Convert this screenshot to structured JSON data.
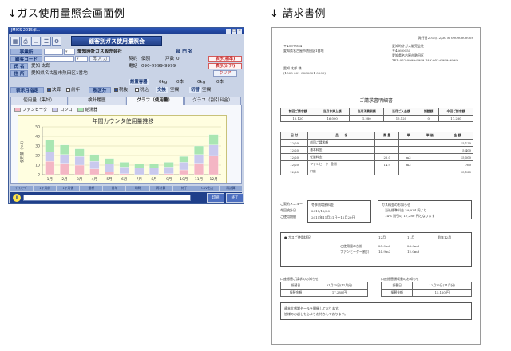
{
  "headings": {
    "left": "↓ガス使用量照会画面例",
    "right": "↓ 請求書例"
  },
  "app": {
    "title": "JMICS 2015年...",
    "banner": "顧客別ガス使用量照会",
    "office_label": "事業所",
    "office_value": "愛知時計ガス販売会社",
    "dept_label": "部 門 名",
    "customer_code_label": "顧客コード",
    "input_button": "再 入 力",
    "name_label": "氏 名",
    "name_value": "愛知 太郎",
    "address_label": "住 所",
    "address_value": "愛知県名古屋市熱田区1番地",
    "contract_label": "契約",
    "contract_value": "個別",
    "households_label": "戸数",
    "households_value": "0",
    "phone_label": "電話",
    "phone_value": "090-9999-9999",
    "display_std": "表示(標準)",
    "display_kana": "表示(ｶﾅﾌﾘ)",
    "clear_button": "クリア",
    "capacity_label": "設置容器",
    "capacity_value1": "0kg",
    "capacity_value2": "0本",
    "capacity_value3": "0kg",
    "capacity_value4": "0本",
    "exchange_label": "交換",
    "exchange_value": "空欄",
    "cut_label": "切替",
    "cut_value": "空欄",
    "display_month_label": "表示月指定",
    "opt_settle": "決算",
    "opt_year": "前年",
    "tax_label": "税区分",
    "opt_tax_excl": "税抜",
    "opt_tax_incl": "税込",
    "tabs": [
      "使用量（集計）",
      "検針履歴",
      "グラフ（使用量）",
      "グラフ（割引料金）"
    ],
    "legend": [
      "ファンヒータ",
      "コンロ",
      "給湯器"
    ],
    "footbar": [
      "ｸﾞﾗﾌﾓｰﾄﾞ",
      "1ヶ月前",
      "1ヶ月後",
      "最新",
      "前年",
      "印刷",
      "再計算",
      "終了",
      "CSV出力",
      "再計算"
    ],
    "action_buttons": [
      "印刷",
      "終了"
    ],
    "colors": {
      "banner": "#2c4fa2",
      "fan_heater": "#f4b6c4",
      "stove": "#c9c9ee",
      "water_heater": "#a9e6b2"
    }
  },
  "chart_data": {
    "type": "bar",
    "title": "年間カウンタ使用量推移",
    "ylabel": "使用量（m3）",
    "categories": [
      "1月",
      "2月",
      "3月",
      "4月",
      "5月",
      "6月",
      "7月",
      "8月",
      "9月",
      "10月",
      "11月",
      "12月"
    ],
    "ylim": [
      0,
      50
    ],
    "y_ticks": [
      0,
      10,
      20,
      30,
      40,
      50
    ],
    "series": [
      {
        "name": "ファンヒータ",
        "values": [
          14,
          12,
          10,
          6,
          3,
          1,
          0,
          0,
          1,
          5,
          12,
          20
        ]
      },
      {
        "name": "コンロ",
        "values": [
          10,
          9,
          9,
          8,
          8,
          7,
          7,
          7,
          7,
          8,
          9,
          11
        ]
      },
      {
        "name": "給湯器",
        "values": [
          12,
          10,
          8,
          7,
          6,
          5,
          4,
          4,
          5,
          6,
          9,
          11
        ]
      }
    ]
  },
  "doc": {
    "date_line": "発行日2015/12/30  № 00000000008",
    "to_zip": "〒456-0054",
    "to_addr": "愛知県名古屋市熱田区1番地",
    "from_company": "愛知時計ガス販売会社",
    "from_zip": "〒456-0054",
    "from_addr": "愛知県名古屋市熱田区",
    "from_tel": "TEL:052-0999-9999   FAX:052-0999-9999",
    "customer": "愛知  太郎  様",
    "customer_no": "(1500-001-0000001-0000)",
    "title": "ご請求書明細書",
    "summary_headers": [
      "前回ご請求額",
      "当月お買上額",
      "当月消費税額",
      "当月ご入金額",
      "調整額",
      "今回ご請求額"
    ],
    "summary_values": [
      "15,120",
      "16,000",
      "1,280",
      "15,120",
      "0",
      "17,280"
    ],
    "detail_headers": [
      "日 付",
      "品　　名",
      "数 量",
      "単",
      "単 価",
      "金 額"
    ],
    "details": [
      [
        "12/20",
        "前回ご請求額",
        "",
        "",
        "",
        "15,120"
      ],
      [
        "12/20",
        "基本料金",
        "",
        "",
        "",
        "5,400"
      ],
      [
        "12/20",
        "従量料金",
        "25.0",
        "m3",
        "",
        "15,500"
      ],
      [
        "12/20",
        "ファンヒーター割引",
        "14.9",
        "m3",
        "",
        "760"
      ],
      [
        "12/25",
        "口座",
        "",
        "",
        "",
        "15,120"
      ]
    ],
    "next_meter_label": "ご契約メニュー",
    "next_meter_value": "冬季割増割料金",
    "prev_meter_label": "今回検針日",
    "prev_meter_value": "2015/12/20",
    "period_label": "ご使用期間",
    "period_value": "2015年11月21日～12月20日",
    "notice_title": "ガス料金のお知らせ",
    "notice_line1": "当社標準料金   29,034  円より",
    "notice_line2": "14%  割引の   17,280  円となります",
    "usage_title": "● ガスご使用状況",
    "usage_month1": "12月",
    "usage_month2": "11月",
    "usage_month3": "前年12月",
    "usage_total_label": "ご使用量の合計",
    "usage_total1": "25.0m3",
    "usage_total2": "26.0m3",
    "usage_fan_label": "ファンヒーター割引",
    "usage_fan1": "14.9m3",
    "usage_fan2": "12.0m3",
    "bottom_left_title": "口座振替ご請求のお知らせ",
    "bottom_left_r1": [
      "振替日",
      "01月25日(11月分)"
    ],
    "bottom_left_r2": [
      "振替金額",
      "17,280 円"
    ],
    "bottom_right_title": "口座振替領収書のお知らせ",
    "bottom_right_r1": [
      "振替日",
      "12月25日(11月分)"
    ],
    "bottom_right_r2": [
      "振替金額",
      "15,120 円"
    ],
    "message1": "歳末大感謝セールを開催しております。",
    "message2": "皆様のお越しを心よりお待ちしております。"
  }
}
